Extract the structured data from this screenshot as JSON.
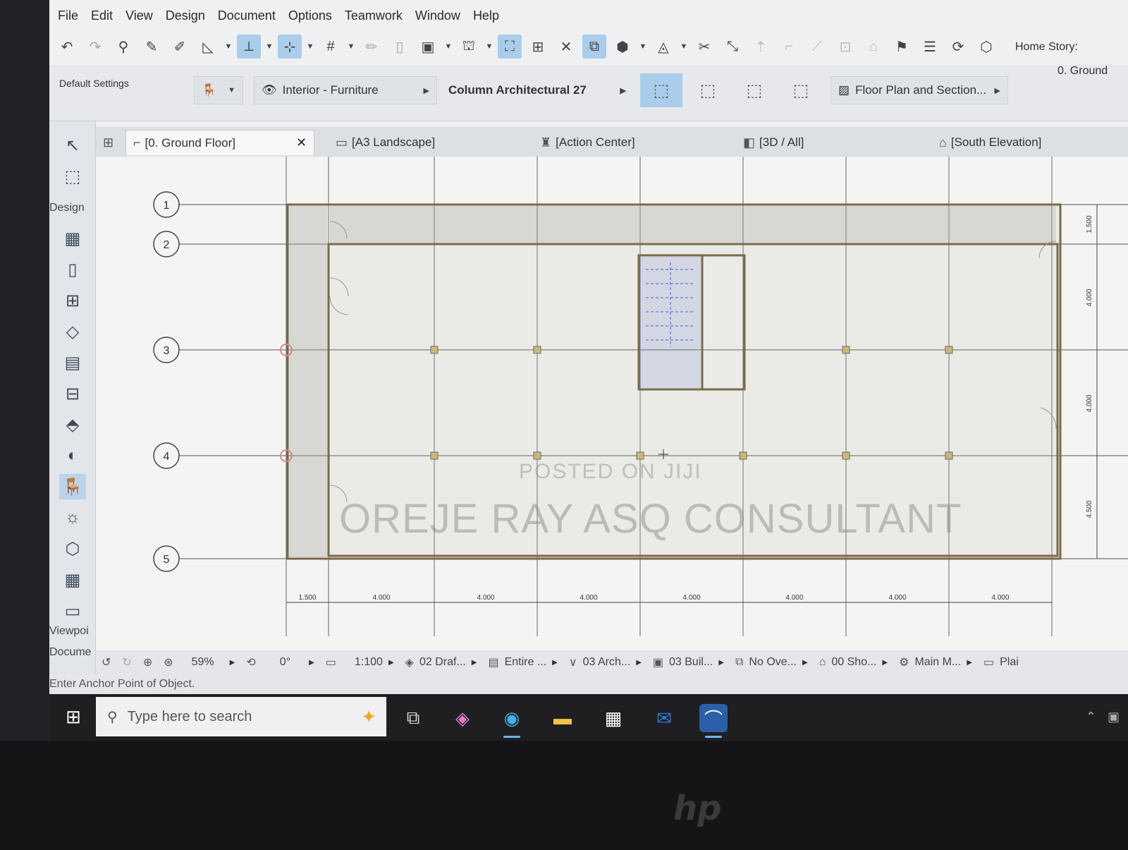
{
  "menubar": {
    "items": [
      "File",
      "Edit",
      "View",
      "Design",
      "Document",
      "Options",
      "Teamwork",
      "Window",
      "Help"
    ]
  },
  "infobox": {
    "settings_label": "Default Settings",
    "layer": "Interior - Furniture",
    "object_name": "Column Architectural 27",
    "view_mode": "Floor Plan and Section...",
    "home_story_label": "Home Story:",
    "home_story_value": "0. Ground"
  },
  "toolbox": {
    "section_design": "Design",
    "section_viewpoint": "Viewpoi",
    "section_document": "Docume"
  },
  "tabs": [
    {
      "label": "[0. Ground Floor]",
      "icon": "floor-plan-icon"
    },
    {
      "label": "[A3 Landscape]",
      "icon": "layout-icon"
    },
    {
      "label": "[Action Center]",
      "icon": "action-center-icon"
    },
    {
      "label": "[3D / All]",
      "icon": "3d-icon"
    },
    {
      "label": "[South Elevation]",
      "icon": "elevation-icon"
    }
  ],
  "drawing": {
    "grid_rows": [
      "1",
      "2",
      "3",
      "4",
      "5"
    ],
    "dimensions_bottom": [
      "1.500",
      "4.000",
      "4.000",
      "4.000",
      "4.000",
      "4.000",
      "4.000",
      "4.000"
    ],
    "dimensions_right": [
      "1.500",
      "4.000",
      "4.000",
      "4.500"
    ],
    "watermark_line1": "POSTED ON JIJI",
    "watermark_line2": "OREJE RAY ASQ CONSULTANT"
  },
  "quickbar": {
    "zoom": "59%",
    "angle": "0°",
    "scale": "1:100",
    "layer_combo": "02 Draf...",
    "structure": "Entire ...",
    "pen_set": "03 Arch...",
    "model_view": "03 Buil...",
    "override": "No Ove...",
    "renovation": "00 Sho...",
    "dimension": "Main M...",
    "plan": "Plai"
  },
  "status": {
    "message": "Enter Anchor Point of Object."
  },
  "taskbar": {
    "search_placeholder": "Type here to search"
  }
}
